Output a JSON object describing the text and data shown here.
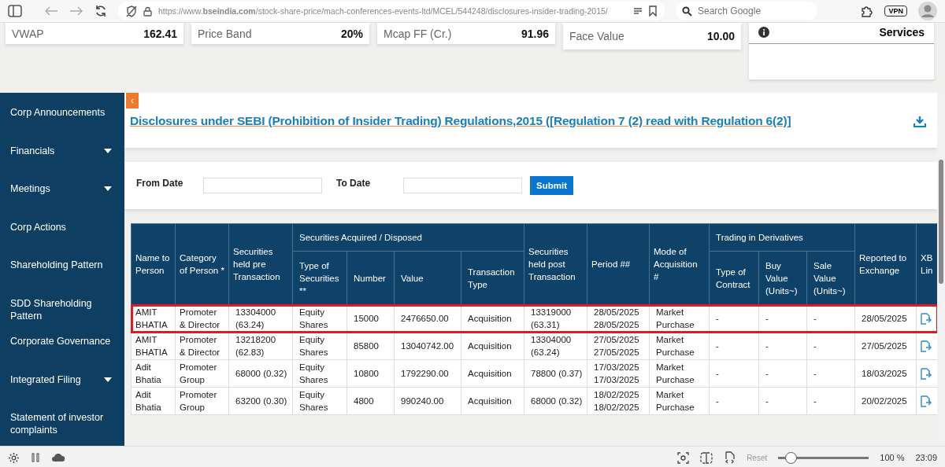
{
  "browser": {
    "url": "https://www.**bseindia.com**/stock-share-price/mach-conferences-events-ltd/MCEL/544248/disclosures-insider-trading-2015/",
    "search_placeholder": "Search Google",
    "vpn_label": "VPN"
  },
  "stats": [
    {
      "label": "VWAP",
      "value": "162.41"
    },
    {
      "label": "Price Band",
      "value": "20%"
    },
    {
      "label": "Mcap FF (Cr.)",
      "value": "91.96"
    },
    {
      "label": "Face Value",
      "value": "10.00"
    }
  ],
  "info_card": {
    "text": "Services"
  },
  "sidebar": {
    "items": [
      {
        "label": "Corp Announcements",
        "expandable": false
      },
      {
        "label": "Financials",
        "expandable": true
      },
      {
        "label": "Meetings",
        "expandable": true
      },
      {
        "label": "Corp Actions",
        "expandable": false
      },
      {
        "label": "Shareholding Pattern",
        "expandable": false
      },
      {
        "label": "SDD Shareholding Pattern",
        "expandable": false
      },
      {
        "label": "Corporate Governance",
        "expandable": false
      },
      {
        "label": "Integrated Filing",
        "expandable": true
      },
      {
        "label": "Statement of investor complaints",
        "expandable": false
      }
    ]
  },
  "collapse_button": "‹",
  "disclosures": {
    "title": "Disclosures under SEBI (Prohibition of Insider Trading) Regulations,2015 ([Regulation 7 (2) read with Regulation 6(2)]"
  },
  "filter": {
    "from_label": "From Date",
    "to_label": "To Date",
    "submit": "Submit"
  },
  "table": {
    "headers": [
      {
        "label": "Name to Person"
      },
      {
        "label": "Category of Person *"
      },
      {
        "label": "Securities held pre Transaction"
      },
      {
        "label": "Securities Acquired / Disposed",
        "columns": [
          "Type of Securities **",
          "Number",
          "Value",
          "Transaction Type"
        ]
      },
      {
        "label": "Securities held post Transaction"
      },
      {
        "label": "Period ##"
      },
      {
        "label": "Mode of Acquisition #"
      },
      {
        "label": "Trading in Derivatives",
        "columns": [
          "Type of Contract",
          "Buy Value (Units~)",
          "Sale Value (Units~)"
        ]
      },
      {
        "label": "Reported to Exchange"
      },
      {
        "label": "XB Lin"
      }
    ],
    "rows": [
      {
        "highlighted": true,
        "cells": [
          "AMIT BHATIA",
          "Promoter & Director",
          "13304000 (63.24)",
          "Equity Shares",
          "15000",
          "2476650.00",
          "Acquisition",
          "13319000 (63.31)",
          "28/05/2025 28/05/2025",
          "Market Purchase",
          "-",
          "-",
          "-",
          "28/05/2025"
        ]
      },
      {
        "highlighted": false,
        "cells": [
          "AMIT BHATIA",
          "Promoter & Director",
          "13218200 (62.83)",
          "Equity Shares",
          "85800",
          "13040742.00",
          "Acquisition",
          "13304000 (63.24)",
          "27/05/2025 27/05/2025",
          "Market Purchase",
          "-",
          "-",
          "-",
          "27/05/2025"
        ]
      },
      {
        "highlighted": false,
        "cells": [
          "Adit Bhatia",
          "Promoter Group",
          "68000 (0.32)",
          "Equity Shares",
          "10800",
          "1792290.00",
          "Acquisition",
          "78800 (0.37)",
          "17/03/2025 17/03/2025",
          "Market Purchase",
          "-",
          "-",
          "-",
          "18/03/2025"
        ]
      },
      {
        "highlighted": false,
        "cells": [
          "Adit Bhatia",
          "Promoter Group",
          "63200 (0.30)",
          "Equity Shares",
          "4800",
          "990240.00",
          "Acquisition",
          "68000 (0.32)",
          "18/02/2025 18/02/2025",
          "Market Purchase",
          "-",
          "-",
          "-",
          "20/02/2025"
        ]
      }
    ]
  },
  "status_bar": {
    "reset_label": "Reset",
    "zoom_level": {
      "level": 0.14
    },
    "zoom_percent": "100 %",
    "time": "23:09"
  }
}
